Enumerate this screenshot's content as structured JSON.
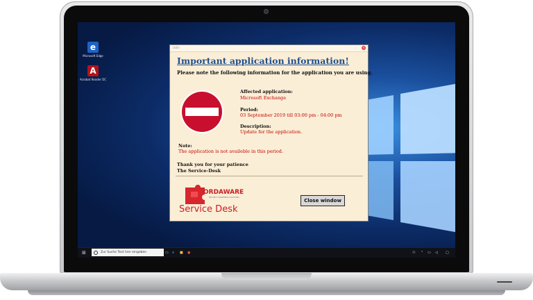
{
  "dialog": {
    "window_title": "info",
    "heading": "Important application information!",
    "intro": "Please note the following information for the application you are using.",
    "affected_label": "Affected application:",
    "affected_value": "Microsoft Exchange",
    "period_label": "Period:",
    "period_value": "03 September 2019 till 03:00 pm - 04:00 pm",
    "description_label": "Description:",
    "description_value": "Update for the application.",
    "note_label": "Note:",
    "note_value": "The application is not availeble in this period.",
    "thanks_line1": "Thank you for your patience",
    "thanks_line2": "The Service-Desk",
    "logo_text": "ORDAWARE",
    "logo_subtext": "SECURITY AWARENESS SOLUTIONS",
    "service_desk": "Service Desk",
    "close_button": "Close window"
  },
  "desktop": {
    "icons": [
      {
        "label": "Microsoft Edge",
        "icon": "edge-icon"
      },
      {
        "label": "Acrobat Reader DC",
        "icon": "acrobat-icon"
      }
    ]
  },
  "taskbar": {
    "search_placeholder": "Zur Suche Text hier eingeben"
  },
  "colors": {
    "heading": "#1f4f8f",
    "alert_red": "#c00000",
    "brand_red": "#c81d25",
    "dialog_bg": "#fbeed6"
  }
}
